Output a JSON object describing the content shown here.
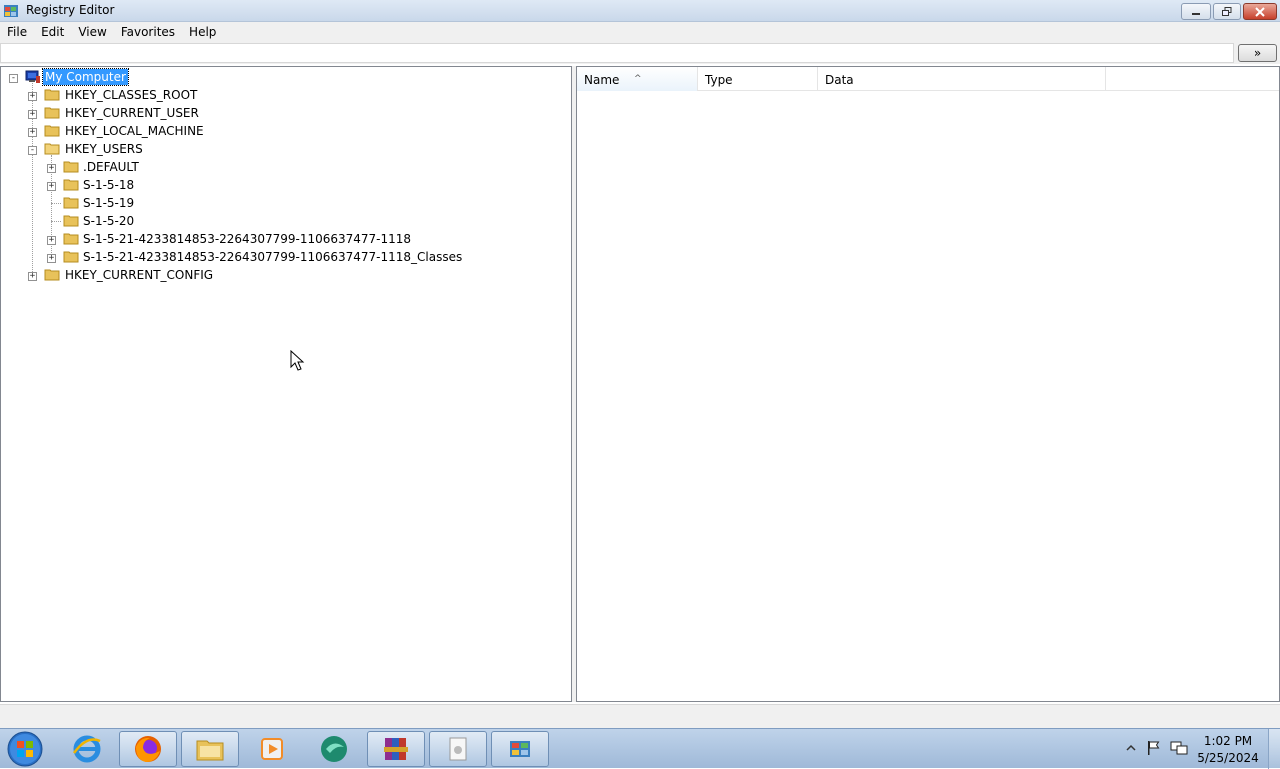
{
  "window": {
    "title": "Registry Editor",
    "buttons": {
      "minimize": "minimize",
      "maximize": "restore",
      "close": "close"
    }
  },
  "menu": [
    "File",
    "Edit",
    "View",
    "Favorites",
    "Help"
  ],
  "address": {
    "value": "",
    "go_label": "»"
  },
  "tree": {
    "root": {
      "label": "My Computer",
      "icon": "computer-icon",
      "expanded": true,
      "selected": true
    },
    "items": [
      {
        "label": "HKEY_CLASSES_ROOT",
        "level": 1,
        "expander": "+"
      },
      {
        "label": "HKEY_CURRENT_USER",
        "level": 1,
        "expander": "+"
      },
      {
        "label": "HKEY_LOCAL_MACHINE",
        "level": 1,
        "expander": "+"
      },
      {
        "label": "HKEY_USERS",
        "level": 1,
        "expander": "-"
      },
      {
        "label": ".DEFAULT",
        "level": 2,
        "expander": "+"
      },
      {
        "label": "S-1-5-18",
        "level": 2,
        "expander": "+"
      },
      {
        "label": "S-1-5-19",
        "level": 2,
        "expander": ""
      },
      {
        "label": "S-1-5-20",
        "level": 2,
        "expander": ""
      },
      {
        "label": "S-1-5-21-4233814853-2264307799-1106637477-1118",
        "level": 2,
        "expander": "+"
      },
      {
        "label": "S-1-5-21-4233814853-2264307799-1106637477-1118_Classes",
        "level": 2,
        "expander": "+"
      },
      {
        "label": "HKEY_CURRENT_CONFIG",
        "level": 1,
        "expander": "+"
      }
    ]
  },
  "list": {
    "columns": {
      "name": "Name",
      "type": "Type",
      "data": "Data"
    },
    "sorted_by": "Name",
    "rows": []
  },
  "taskbar": {
    "apps": [
      {
        "name": "internet-explorer-icon",
        "active": false
      },
      {
        "name": "firefox-icon",
        "active": true
      },
      {
        "name": "file-explorer-icon",
        "active": true
      },
      {
        "name": "media-player-icon",
        "active": false
      },
      {
        "name": "browser-app-icon",
        "active": false
      },
      {
        "name": "winrar-icon",
        "active": true
      },
      {
        "name": "document-app-icon",
        "active": true
      },
      {
        "name": "registry-editor-icon",
        "active": true
      }
    ],
    "clock": {
      "time": "1:02 PM",
      "date": "5/25/2024"
    }
  },
  "colors": {
    "selection": "#3399ff",
    "taskbar": "#a8c0dd",
    "titlebar": "#d3e0ef"
  }
}
